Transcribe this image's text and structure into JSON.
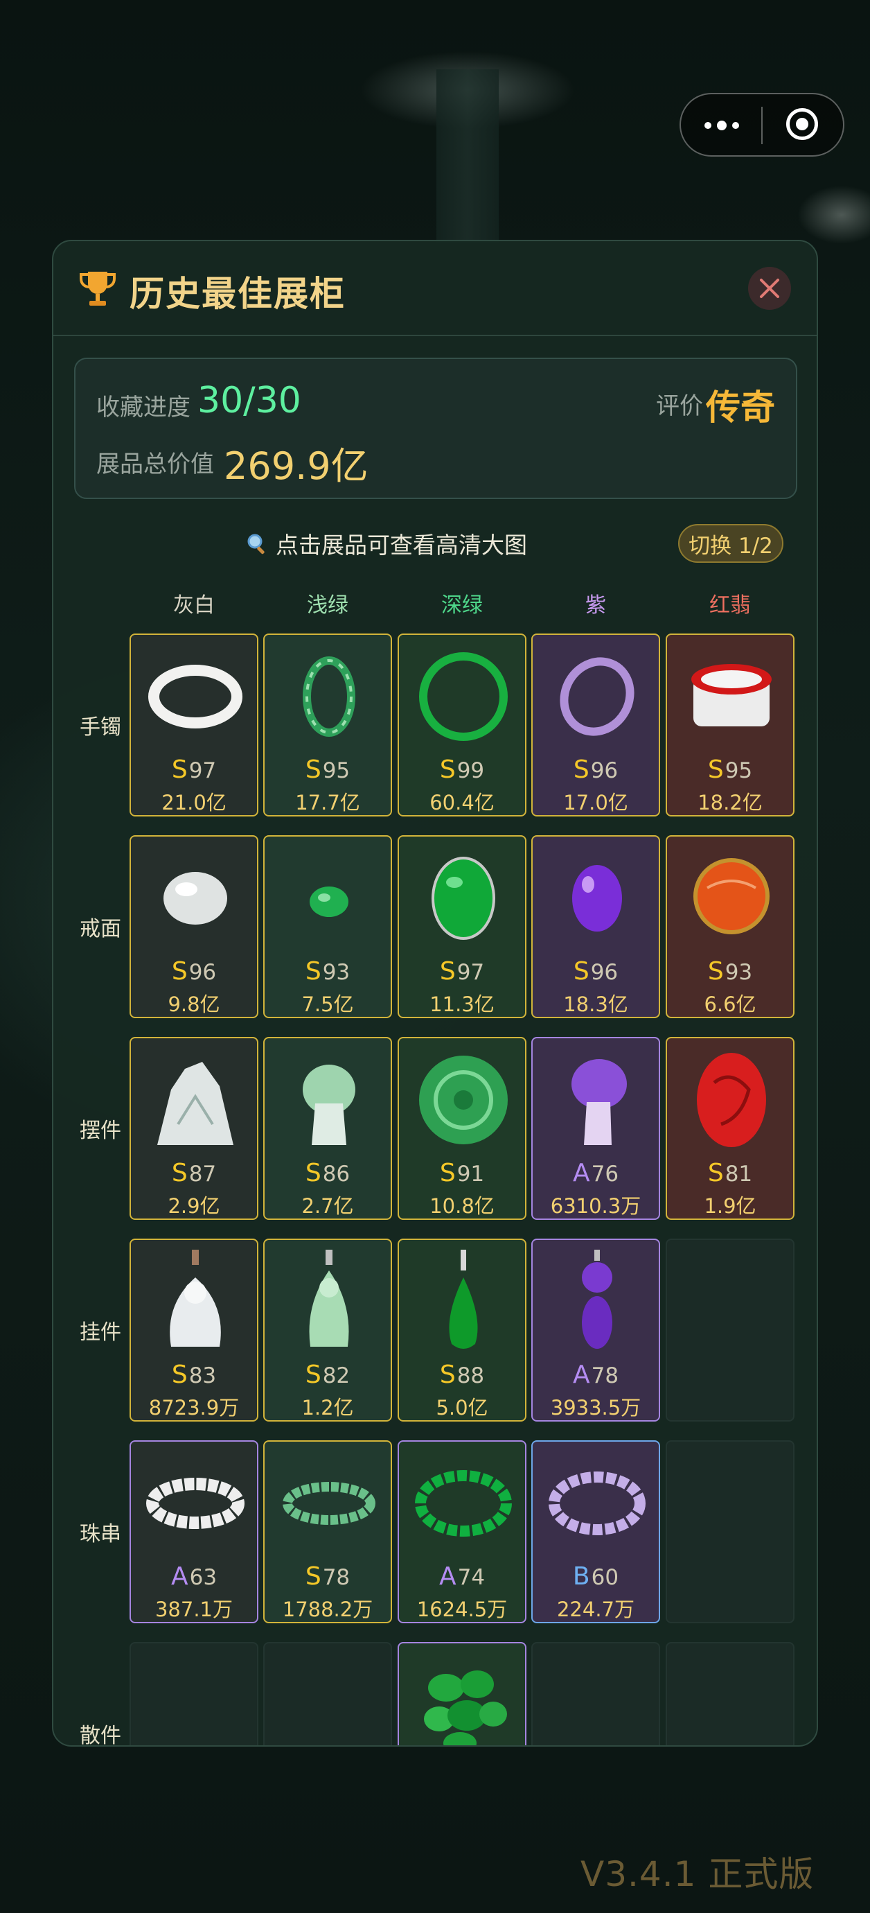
{
  "window": {
    "more_icon": "more-dots-icon",
    "close_icon": "target-circle-icon"
  },
  "dialog": {
    "title": "历史最佳展柜",
    "trophy_icon": "trophy-icon",
    "close_icon": "close-icon"
  },
  "stats": {
    "progress_label": "收藏进度",
    "progress_value": "30/30",
    "rating_label": "评价",
    "rating_value": "传奇",
    "total_label": "展品总价值",
    "total_value": "269.9亿"
  },
  "hint": {
    "icon": "magnifier-icon",
    "text": "点击展品可查看高清大图"
  },
  "switch_label": "切换 1/2",
  "columns": [
    {
      "label": "灰白",
      "color": "#d8d4c4"
    },
    {
      "label": "浅绿",
      "color": "#9fe0b0"
    },
    {
      "label": "深绿",
      "color": "#4ed68a"
    },
    {
      "label": "紫",
      "color": "#c89af0"
    },
    {
      "label": "红翡",
      "color": "#ef7060"
    }
  ],
  "rows": [
    {
      "label": "手镯",
      "items": [
        {
          "grade": "S",
          "score": "97",
          "value": "21.0亿",
          "art": "white-bangle"
        },
        {
          "grade": "S",
          "score": "95",
          "value": "17.7亿",
          "art": "green-mottled-bangle"
        },
        {
          "grade": "S",
          "score": "99",
          "value": "60.4亿",
          "art": "deep-green-bangle"
        },
        {
          "grade": "S",
          "score": "96",
          "value": "17.0亿",
          "art": "purple-bangle"
        },
        {
          "grade": "S",
          "score": "95",
          "value": "18.2亿",
          "art": "red-bangle"
        }
      ]
    },
    {
      "label": "戒面",
      "items": [
        {
          "grade": "S",
          "score": "96",
          "value": "9.8亿",
          "art": "white-cabochon"
        },
        {
          "grade": "S",
          "score": "93",
          "value": "7.5亿",
          "art": "green-cabochon"
        },
        {
          "grade": "S",
          "score": "97",
          "value": "11.3亿",
          "art": "green-oval-ring-face"
        },
        {
          "grade": "S",
          "score": "96",
          "value": "18.3亿",
          "art": "purple-cabochon"
        },
        {
          "grade": "S",
          "score": "93",
          "value": "6.6亿",
          "art": "red-carved-ring"
        }
      ]
    },
    {
      "label": "摆件",
      "items": [
        {
          "grade": "S",
          "score": "87",
          "value": "2.9亿",
          "art": "white-mountain-carving"
        },
        {
          "grade": "S",
          "score": "86",
          "value": "2.7亿",
          "art": "light-green-cabbage"
        },
        {
          "grade": "S",
          "score": "91",
          "value": "10.8亿",
          "art": "green-dragon-disc"
        },
        {
          "grade": "A",
          "score": "76",
          "value": "6310.3万",
          "art": "purple-cabbage"
        },
        {
          "grade": "S",
          "score": "81",
          "value": "1.9亿",
          "art": "red-carved-pendant"
        }
      ]
    },
    {
      "label": "挂件",
      "items": [
        {
          "grade": "S",
          "score": "83",
          "value": "8723.9万",
          "art": "white-buddha-pendant"
        },
        {
          "grade": "S",
          "score": "82",
          "value": "1.2亿",
          "art": "light-green-guanyin"
        },
        {
          "grade": "S",
          "score": "88",
          "value": "5.0亿",
          "art": "green-drop-pendant"
        },
        {
          "grade": "A",
          "score": "78",
          "value": "3933.5万",
          "art": "purple-ruyi-pendant"
        },
        null
      ]
    },
    {
      "label": "珠串",
      "items": [
        {
          "grade": "A",
          "score": "63",
          "value": "387.1万",
          "art": "white-bead-bracelet"
        },
        {
          "grade": "S",
          "score": "78",
          "value": "1788.2万",
          "art": "light-green-bead-bracelet"
        },
        {
          "grade": "A",
          "score": "74",
          "value": "1624.5万",
          "art": "green-bead-bracelet"
        },
        {
          "grade": "B",
          "score": "60",
          "value": "224.7万",
          "art": "lavender-bead-bracelet"
        },
        null
      ]
    },
    {
      "label": "散件",
      "items": [
        null,
        null,
        {
          "grade": "",
          "score": "",
          "value": "",
          "art": "green-rough-stones"
        },
        null,
        null
      ]
    }
  ],
  "version": "V3.4.1 正式版"
}
